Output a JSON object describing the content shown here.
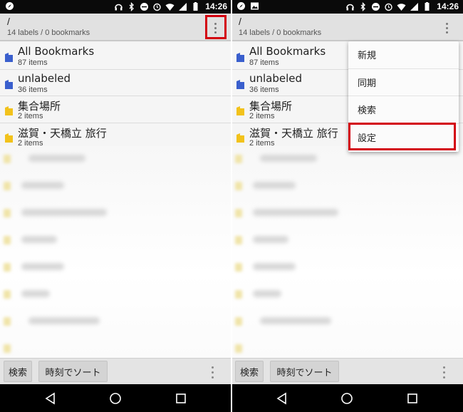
{
  "status": {
    "time": "14:26"
  },
  "appbar": {
    "path": "/",
    "subtitle": "14 labels / 0 bookmarks"
  },
  "list": {
    "items": [
      {
        "title": "All Bookmarks",
        "count": "87 items",
        "icon": "blue-folder-icon"
      },
      {
        "title": "unlabeled",
        "count": "36 items",
        "icon": "blue-folder-icon"
      },
      {
        "title": "集合場所",
        "count": "2 items",
        "icon": "yellow-folder-icon"
      },
      {
        "title": "滋賀・天橋立 旅行",
        "count": "2 items",
        "icon": "yellow-folder-icon"
      }
    ]
  },
  "bottombar": {
    "search_label": "検索",
    "sort_label": "時刻でソート"
  },
  "menu": {
    "items": [
      {
        "label": "新規"
      },
      {
        "label": "同期"
      },
      {
        "label": "検索"
      },
      {
        "label": "設定"
      }
    ]
  },
  "colors": {
    "highlight": "#d3000f",
    "blue_folder": "#3a5fcd",
    "yellow_folder": "#f2c21b",
    "appbar": "#e1e1e1"
  }
}
